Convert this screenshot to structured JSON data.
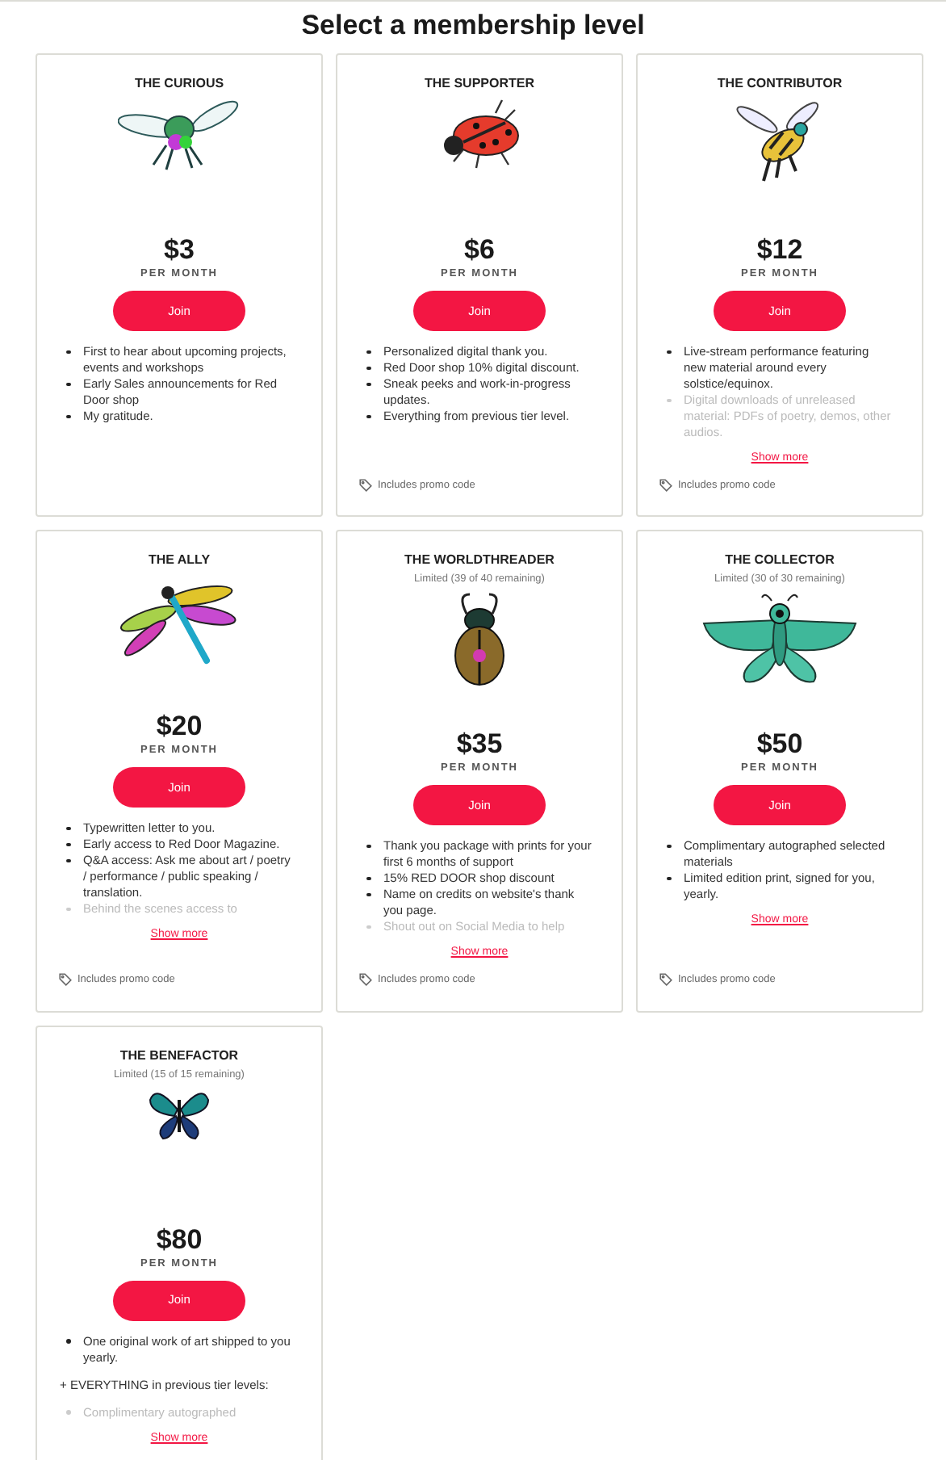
{
  "title": "Select a membership level",
  "tiers": [
    {
      "name": "THE CURIOUS",
      "kind": "fly",
      "price": "$3",
      "period": "PER MONTH",
      "button": "Join",
      "benefits": [
        {
          "kind": "bullet",
          "text": "First to hear about upcoming projects, events and workshops",
          "faded": false
        },
        {
          "kind": "bullet",
          "text": "Early Sales announcements for Red Door shop",
          "faded": false
        },
        {
          "kind": "bullet",
          "text": "My gratitude.",
          "faded": false
        }
      ]
    },
    {
      "name": "THE SUPPORTER",
      "kind": "ladybug",
      "price": "$6",
      "period": "PER MONTH",
      "button": "Join",
      "benefits": [
        {
          "kind": "bullet",
          "text": "Personalized digital thank you.",
          "faded": false
        },
        {
          "kind": "bullet",
          "text": "Red Door shop 10% digital discount.",
          "faded": false
        },
        {
          "kind": "bullet",
          "text": "Sneak peeks and work-in-progress updates.",
          "faded": false
        },
        {
          "kind": "bullet",
          "text": "Everything from previous tier level.",
          "faded": false
        }
      ],
      "promo": "Includes promo code"
    },
    {
      "name": "THE CONTRIBUTOR",
      "kind": "bee",
      "price": "$12",
      "period": "PER MONTH",
      "button": "Join",
      "benefits": [
        {
          "kind": "bullet",
          "text": "Live-stream performance featuring new material around every solstice/equinox.",
          "faded": false
        },
        {
          "kind": "bullet",
          "text": "Digital downloads of unreleased material: PDFs of poetry, demos, other audios.",
          "faded": true
        }
      ],
      "show_more": "Show more",
      "promo": "Includes promo code"
    },
    {
      "name": "THE ALLY",
      "kind": "dragonfly",
      "price": "$20",
      "period": "PER MONTH",
      "button": "Join",
      "benefits": [
        {
          "kind": "bullet",
          "text": "Typewritten letter to you.",
          "faded": false
        },
        {
          "kind": "bullet",
          "text": "Early access to Red Door Magazine.",
          "faded": false
        },
        {
          "kind": "bullet",
          "text": "Q&A access: Ask me about art / poetry / performance / public speaking / translation.",
          "faded": false
        },
        {
          "kind": "bullet",
          "text": "Behind the scenes access to",
          "faded": true
        }
      ],
      "show_more": "Show more",
      "promo": "Includes promo code"
    },
    {
      "name": "THE WORLDTHREADER",
      "limit": "Limited (39 of 40 remaining)",
      "kind": "beetle",
      "price": "$35",
      "period": "PER MONTH",
      "button": "Join",
      "benefits": [
        {
          "kind": "bullet",
          "text": "Thank you package with prints for your first 6 months of support",
          "faded": false
        },
        {
          "kind": "bullet",
          "text": "15% RED DOOR shop discount",
          "faded": false
        },
        {
          "kind": "bullet",
          "text": "Name on credits on website's thank you page.",
          "faded": false
        },
        {
          "kind": "bullet",
          "text": "Shout out on Social Media to help",
          "faded": true
        }
      ],
      "show_more": "Show more",
      "promo": "Includes promo code"
    },
    {
      "name": "THE COLLECTOR",
      "limit": "Limited (30 of 30 remaining)",
      "kind": "moth",
      "price": "$50",
      "period": "PER MONTH",
      "button": "Join",
      "benefits": [
        {
          "kind": "bullet",
          "text": "Complimentary autographed selected materials",
          "faded": false
        },
        {
          "kind": "bullet",
          "text": "Limited edition print, signed for you, yearly.",
          "faded": false
        }
      ],
      "show_more": "Show more",
      "promo": "Includes promo code"
    },
    {
      "name": "THE BENEFACTOR",
      "limit": "Limited (15 of 15 remaining)",
      "kind": "butterfly",
      "price": "$80",
      "period": "PER MONTH",
      "button": "Join",
      "benefits": [
        {
          "kind": "bullet",
          "text": "One original work of art shipped to you yearly.",
          "faded": false
        },
        {
          "kind": "paragraph",
          "text": "+ EVERYTHING in previous tier levels:",
          "faded": false
        },
        {
          "kind": "bullet",
          "text": "Complimentary autographed",
          "faded": true
        }
      ],
      "show_more": "Show more"
    }
  ]
}
